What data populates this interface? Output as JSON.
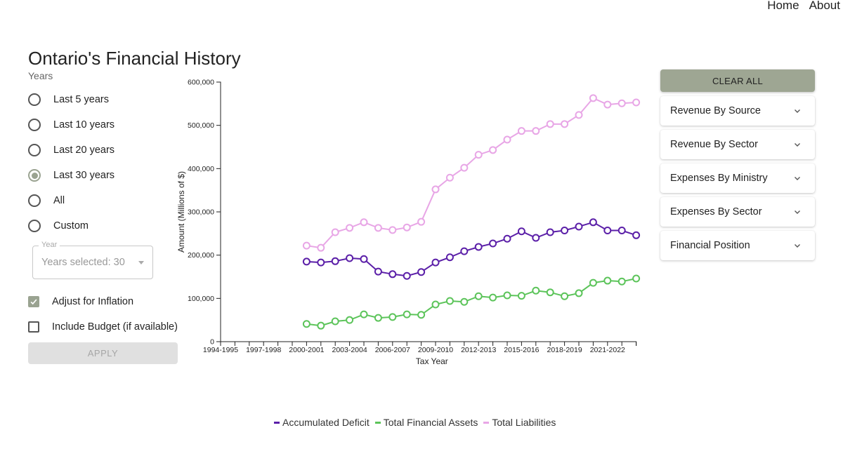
{
  "nav": {
    "home": "Home",
    "about": "About"
  },
  "title": "Ontario's Financial History",
  "filters": {
    "group_label": "Years",
    "options": [
      {
        "label": "Last 5 years",
        "checked": false
      },
      {
        "label": "Last 10 years",
        "checked": false
      },
      {
        "label": "Last 20 years",
        "checked": false
      },
      {
        "label": "Last 30 years",
        "checked": true
      },
      {
        "label": "All",
        "checked": false
      },
      {
        "label": "Custom",
        "checked": false
      }
    ],
    "year_select": {
      "legend": "Year",
      "value": "Years selected: 30"
    },
    "adjust_inflation": {
      "label": "Adjust for Inflation",
      "checked": true
    },
    "include_budget": {
      "label": "Include Budget (if available)",
      "checked": false
    },
    "apply_label": "APPLY"
  },
  "side_panel": {
    "clear_label": "CLEAR ALL",
    "accordions": [
      {
        "label": "Revenue By Source"
      },
      {
        "label": "Revenue By Sector"
      },
      {
        "label": "Expenses By Ministry"
      },
      {
        "label": "Expenses By Sector"
      },
      {
        "label": "Financial Position"
      }
    ]
  },
  "colors": {
    "deficit": "#5b1fa8",
    "assets": "#5cc45a",
    "liabilities": "#e8a6e6"
  },
  "chart_data": {
    "type": "line",
    "title": "",
    "xlabel": "Tax Year",
    "ylabel": "Amount (Millions of $)",
    "ylim": [
      0,
      600000
    ],
    "yticks": [
      0,
      100000,
      200000,
      300000,
      400000,
      500000,
      600000
    ],
    "ytick_labels": [
      "0",
      "100,000",
      "200,000",
      "300,000",
      "400,000",
      "500,000",
      "600,000"
    ],
    "x_axis_years": [
      "1994-1995",
      "1995-1996",
      "1996-1997",
      "1997-1998",
      "1998-1999",
      "1999-2000",
      "2000-2001",
      "2001-2002",
      "2002-2003",
      "2003-2004",
      "2004-2005",
      "2005-2006",
      "2006-2007",
      "2007-2008",
      "2008-2009",
      "2009-2010",
      "2010-2011",
      "2011-2012",
      "2012-2013",
      "2013-2014",
      "2014-2015",
      "2015-2016",
      "2016-2017",
      "2017-2018",
      "2018-2019",
      "2019-2020",
      "2020-2021",
      "2021-2022",
      "2022-2023",
      "2023-2024"
    ],
    "xtick_labels": [
      "1994-1995",
      "1997-1998",
      "2000-2001",
      "2003-2004",
      "2006-2007",
      "2009-2010",
      "2012-2013",
      "2015-2016",
      "2018-2019",
      "2021-2022"
    ],
    "x": [
      "2000-2001",
      "2001-2002",
      "2002-2003",
      "2003-2004",
      "2004-2005",
      "2005-2006",
      "2006-2007",
      "2007-2008",
      "2008-2009",
      "2009-2010",
      "2010-2011",
      "2011-2012",
      "2012-2013",
      "2013-2014",
      "2014-2015",
      "2015-2016",
      "2016-2017",
      "2017-2018",
      "2018-2019",
      "2019-2020",
      "2020-2021",
      "2021-2022",
      "2022-2023",
      "2023-2024"
    ],
    "series": [
      {
        "name": "Accumulated Deficit",
        "key": "deficit",
        "values": [
          185000,
          183000,
          186000,
          193000,
          191000,
          162000,
          156000,
          152000,
          161000,
          183000,
          195000,
          209000,
          219000,
          227000,
          238000,
          255000,
          240000,
          253000,
          257000,
          266000,
          276000,
          257000,
          257000,
          246000
        ]
      },
      {
        "name": "Total Financial Assets",
        "key": "assets",
        "values": [
          41000,
          37000,
          47000,
          50000,
          63000,
          55000,
          57000,
          63000,
          62000,
          86000,
          94000,
          92000,
          105000,
          102000,
          107000,
          106000,
          118000,
          114000,
          105000,
          112000,
          136000,
          141000,
          139000,
          146000
        ]
      },
      {
        "name": "Total Liabilities",
        "key": "liabilities",
        "values": [
          222000,
          217000,
          253000,
          263000,
          276000,
          263000,
          258000,
          264000,
          277000,
          352000,
          379000,
          402000,
          432000,
          443000,
          467000,
          487000,
          487000,
          503000,
          503000,
          524000,
          563000,
          548000,
          551000,
          553000
        ]
      }
    ],
    "legend_position": "bottom",
    "grid": false
  }
}
